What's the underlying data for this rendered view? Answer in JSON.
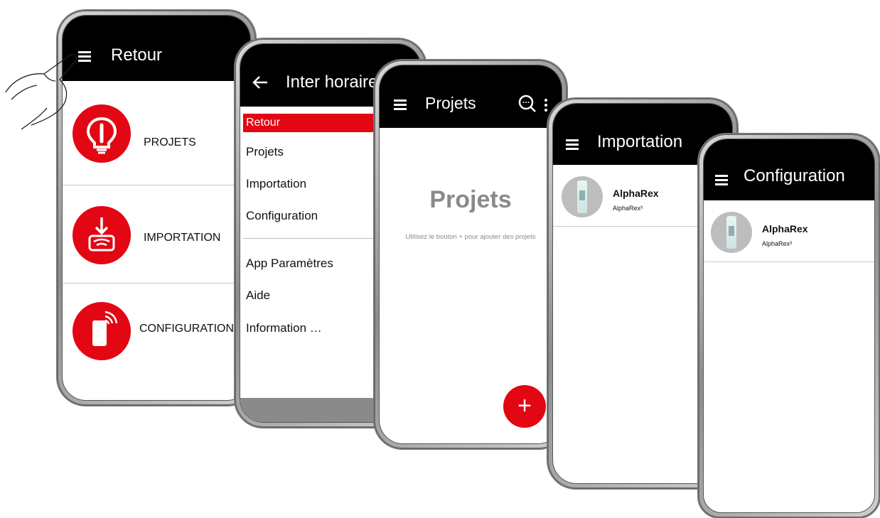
{
  "screens": {
    "home": {
      "title": "Retour",
      "items": [
        {
          "label": "PROJETS",
          "icon": "lightbulb-icon"
        },
        {
          "label": "IMPORTATION",
          "icon": "download-wifi-icon"
        },
        {
          "label": "CONFIGURATION",
          "icon": "device-signal-icon"
        }
      ]
    },
    "drawer": {
      "title": "Inter horaire",
      "active_item": "Retour",
      "items": [
        "Projets",
        "Importation",
        "Configuration"
      ],
      "secondary_items": [
        "App Paramètres",
        "Aide",
        "Information …"
      ]
    },
    "projects": {
      "title": "Projets",
      "empty_heading": "Projets",
      "empty_hint": "Utilisez le bouton + pour ajouter des projets",
      "fab_label": "+"
    },
    "import": {
      "title": "Importation",
      "device_name": "AlphaRex",
      "device_model": "AlphaRex³"
    },
    "config": {
      "title": "Configuration",
      "device_name": "AlphaRex",
      "device_model": "AlphaRex³"
    }
  },
  "colors": {
    "accent": "#e30613",
    "bar": "#000000",
    "muted_text": "#8a8a8a"
  }
}
